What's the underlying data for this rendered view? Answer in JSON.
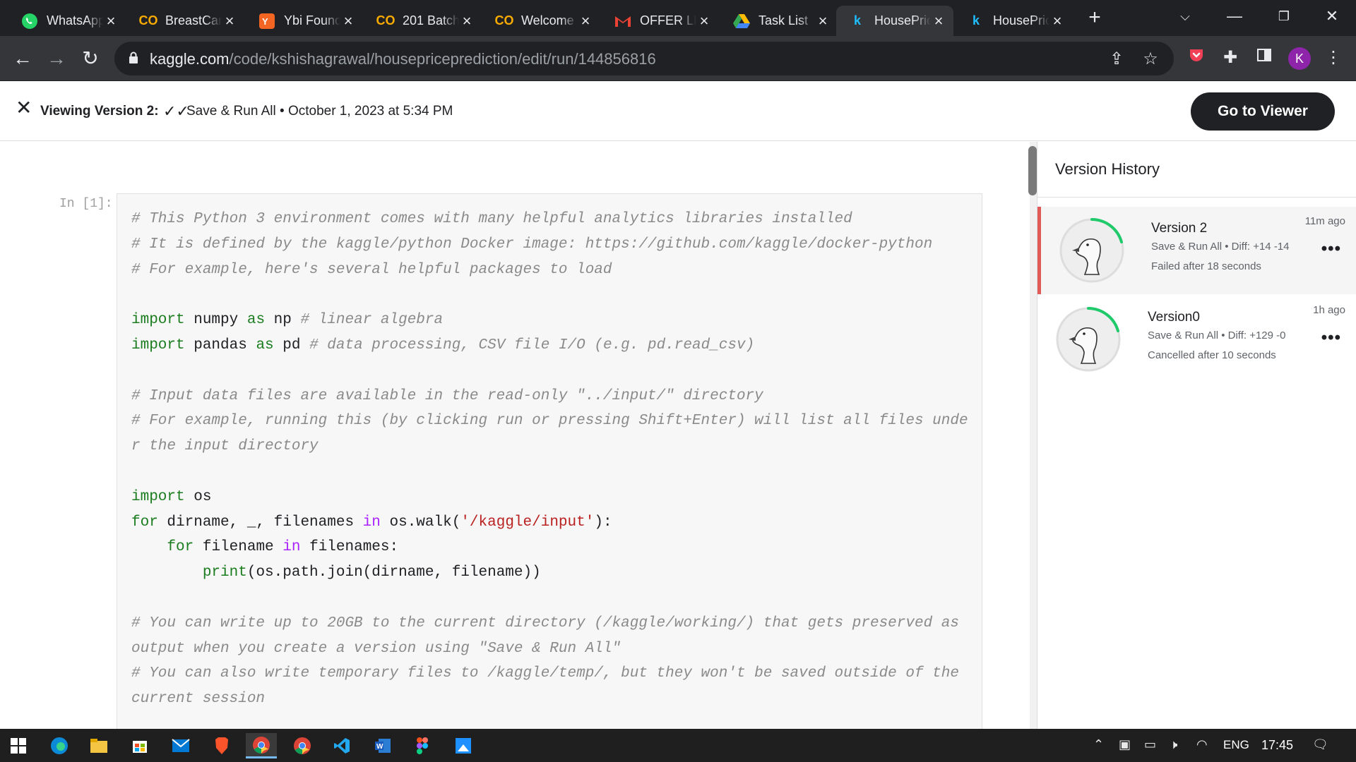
{
  "browser": {
    "tabs": [
      {
        "title": "WhatsApp",
        "icon": "whatsapp-icon",
        "active": false
      },
      {
        "title": "BreastCancer",
        "icon": "colab-icon",
        "active": false
      },
      {
        "title": "Ybi Foundation",
        "icon": "ybi-icon",
        "active": false
      },
      {
        "title": "201 Batch",
        "icon": "colab-icon",
        "active": false
      },
      {
        "title": "Welcome",
        "icon": "colab-icon",
        "active": false
      },
      {
        "title": "OFFER LETTER",
        "icon": "gmail-icon",
        "active": false
      },
      {
        "title": "Task List",
        "icon": "google-drive-icon",
        "active": false
      },
      {
        "title": "HousePrice",
        "icon": "kaggle-icon",
        "active": true
      },
      {
        "title": "HousePrice",
        "icon": "kaggle-icon",
        "active": false
      }
    ],
    "url_host": "kaggle.com",
    "url_path": "/code/kshishagrawal/housepriceprediction/edit/run/144856816",
    "profile_initial": "K"
  },
  "header": {
    "viewing_label": "Viewing Version 2:",
    "version_info": "Save & Run All • October 1, 2023 at 5:34 PM",
    "go_to_viewer": "Go to Viewer"
  },
  "notebook": {
    "prompt": "In [1]:"
  },
  "version_history": {
    "title": "Version History",
    "items": [
      {
        "name": "Version 2",
        "meta": "Save & Run All • Diff: +14 -14",
        "status": "Failed after 18 seconds",
        "time": "11m ago",
        "selected": true
      },
      {
        "name": "Version0",
        "meta": "Save & Run All • Diff: +129 -0",
        "status": "Cancelled after 10 seconds",
        "time": "1h ago",
        "selected": false
      }
    ]
  },
  "taskbar": {
    "lang": "ENG",
    "time": "17:45"
  },
  "colors": {
    "accent_error": "#e05b56",
    "progress_green": "#20beff",
    "button_dark": "#202124"
  }
}
